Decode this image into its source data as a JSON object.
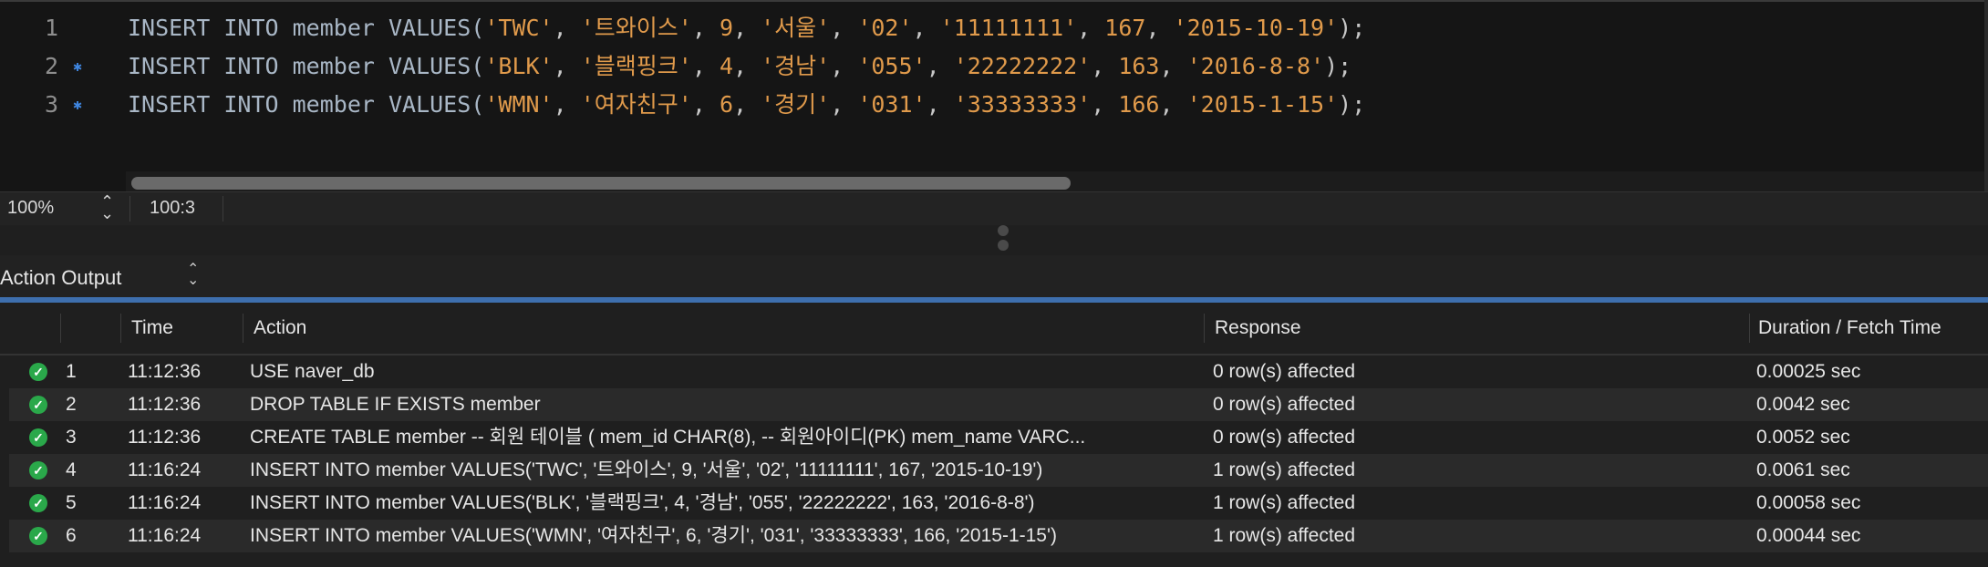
{
  "editor": {
    "lines": [
      {
        "number": "1",
        "marker": false,
        "parts": [
          {
            "t": "kw",
            "v": "INSERT INTO member VALUES("
          },
          {
            "t": "str",
            "v": "'TWC'"
          },
          {
            "t": "punc",
            "v": ", "
          },
          {
            "t": "str",
            "v": "'트와이스'"
          },
          {
            "t": "punc",
            "v": ", "
          },
          {
            "t": "num",
            "v": "9"
          },
          {
            "t": "punc",
            "v": ", "
          },
          {
            "t": "str",
            "v": "'서울'"
          },
          {
            "t": "punc",
            "v": ", "
          },
          {
            "t": "str",
            "v": "'02'"
          },
          {
            "t": "punc",
            "v": ", "
          },
          {
            "t": "str",
            "v": "'11111111'"
          },
          {
            "t": "punc",
            "v": ", "
          },
          {
            "t": "num",
            "v": "167"
          },
          {
            "t": "punc",
            "v": ", "
          },
          {
            "t": "str",
            "v": "'2015-10-19'"
          },
          {
            "t": "punc",
            "v": ");"
          }
        ]
      },
      {
        "number": "2",
        "marker": true,
        "parts": [
          {
            "t": "kw",
            "v": "INSERT INTO member VALUES("
          },
          {
            "t": "str",
            "v": "'BLK'"
          },
          {
            "t": "punc",
            "v": ", "
          },
          {
            "t": "str",
            "v": "'블랙핑크'"
          },
          {
            "t": "punc",
            "v": ", "
          },
          {
            "t": "num",
            "v": "4"
          },
          {
            "t": "punc",
            "v": ", "
          },
          {
            "t": "str",
            "v": "'경남'"
          },
          {
            "t": "punc",
            "v": ", "
          },
          {
            "t": "str",
            "v": "'055'"
          },
          {
            "t": "punc",
            "v": ", "
          },
          {
            "t": "str",
            "v": "'22222222'"
          },
          {
            "t": "punc",
            "v": ", "
          },
          {
            "t": "num",
            "v": "163"
          },
          {
            "t": "punc",
            "v": ", "
          },
          {
            "t": "str",
            "v": "'2016-8-8'"
          },
          {
            "t": "punc",
            "v": ");"
          }
        ]
      },
      {
        "number": "3",
        "marker": true,
        "parts": [
          {
            "t": "kw",
            "v": "INSERT INTO member VALUES("
          },
          {
            "t": "str",
            "v": "'WMN'"
          },
          {
            "t": "punc",
            "v": ", "
          },
          {
            "t": "str",
            "v": "'여자친구'"
          },
          {
            "t": "punc",
            "v": ", "
          },
          {
            "t": "num",
            "v": "6"
          },
          {
            "t": "punc",
            "v": ", "
          },
          {
            "t": "str",
            "v": "'경기'"
          },
          {
            "t": "punc",
            "v": ", "
          },
          {
            "t": "str",
            "v": "'031'"
          },
          {
            "t": "punc",
            "v": ", "
          },
          {
            "t": "str",
            "v": "'33333333'"
          },
          {
            "t": "punc",
            "v": ", "
          },
          {
            "t": "num",
            "v": "166"
          },
          {
            "t": "punc",
            "v": ", "
          },
          {
            "t": "str",
            "v": "'2015-1-15'"
          },
          {
            "t": "punc",
            "v": ");"
          }
        ]
      }
    ]
  },
  "statusbar": {
    "zoom": "100%",
    "cursor": "100:3"
  },
  "output": {
    "title": "Action Output",
    "columns": {
      "time": "Time",
      "action": "Action",
      "response": "Response",
      "duration": "Duration / Fetch Time"
    },
    "rows": [
      {
        "n": "1",
        "time": "11:12:36",
        "action": "USE naver_db",
        "response": "0 row(s) affected",
        "duration": "0.00025 sec"
      },
      {
        "n": "2",
        "time": "11:12:36",
        "action": "DROP TABLE IF EXISTS member",
        "response": "0 row(s) affected",
        "duration": "0.0042 sec"
      },
      {
        "n": "3",
        "time": "11:12:36",
        "action": "CREATE TABLE member -- 회원 테이블 (  mem_id   CHAR(8), -- 회원아이디(PK)     mem_name  VARC...",
        "response": "0 row(s) affected",
        "duration": "0.0052 sec"
      },
      {
        "n": "4",
        "time": "11:16:24",
        "action": "INSERT INTO member VALUES('TWC', '트와이스', 9, '서울', '02', '11111111', 167, '2015-10-19')",
        "response": "1 row(s) affected",
        "duration": "0.0061 sec"
      },
      {
        "n": "5",
        "time": "11:16:24",
        "action": "INSERT INTO member VALUES('BLK', '블랙핑크', 4, '경남', '055', '22222222', 163, '2016-8-8')",
        "response": "1 row(s) affected",
        "duration": "0.00058 sec"
      },
      {
        "n": "6",
        "time": "11:16:24",
        "action": "INSERT INTO member VALUES('WMN', '여자친구', 6, '경기', '031', '33333333', 166, '2015-1-15')",
        "response": "1 row(s) affected",
        "duration": "0.00044 sec"
      }
    ]
  },
  "icons": {
    "success": "success-check-icon",
    "modified": "modified-marker-icon"
  },
  "colors": {
    "accent": "#3e6fae",
    "success": "#2aa84a",
    "string": "#e09a4b",
    "marker": "#3f86e0"
  }
}
